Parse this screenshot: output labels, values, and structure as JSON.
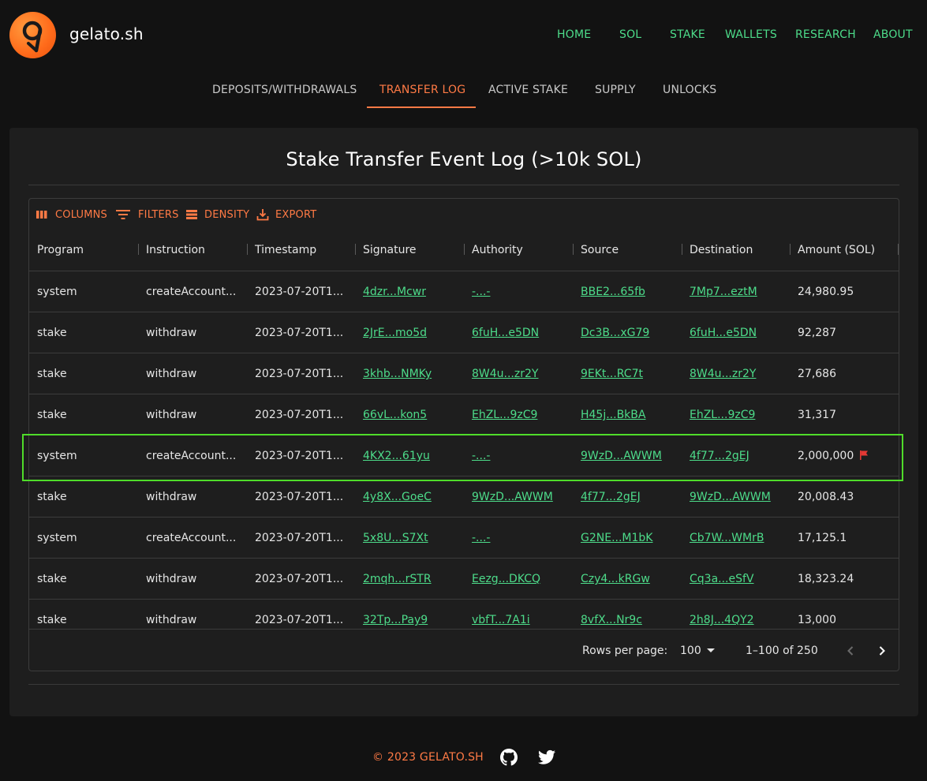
{
  "brand": {
    "name": "gelato.sh"
  },
  "nav": [
    {
      "label": "HOME"
    },
    {
      "label": "SOL"
    },
    {
      "label": "STAKE"
    },
    {
      "label": "WALLETS"
    },
    {
      "label": "RESEARCH"
    },
    {
      "label": "ABOUT"
    }
  ],
  "tabs": [
    {
      "label": "DEPOSITS/WITHDRAWALS",
      "active": false
    },
    {
      "label": "TRANSFER LOG",
      "active": true
    },
    {
      "label": "ACTIVE STAKE",
      "active": false
    },
    {
      "label": "SUPPLY",
      "active": false
    },
    {
      "label": "UNLOCKS",
      "active": false
    }
  ],
  "card": {
    "title": "Stake Transfer Event Log (>10k SOL)"
  },
  "toolbar": {
    "columns": "COLUMNS",
    "filters": "FILTERS",
    "density": "DENSITY",
    "export": "EXPORT"
  },
  "columns": [
    "Program",
    "Instruction",
    "Timestamp",
    "Signature",
    "Authority",
    "Source",
    "Destination",
    "Amount (SOL)"
  ],
  "rows": [
    {
      "program": "system",
      "instruction": "createAccount...",
      "timestamp": "2023-07-20T1...",
      "signature": "4dzr...Mcwr",
      "authority": "-...-",
      "source": "BBE2...65fb",
      "destination": "7Mp7...eztM",
      "amount": "24,980.95",
      "flagged": false
    },
    {
      "program": "stake",
      "instruction": "withdraw",
      "timestamp": "2023-07-20T1...",
      "signature": "2JrE...mo5d",
      "authority": "6fuH...e5DN",
      "source": "Dc3B...xG79",
      "destination": "6fuH...e5DN",
      "amount": "92,287",
      "flagged": false
    },
    {
      "program": "stake",
      "instruction": "withdraw",
      "timestamp": "2023-07-20T1...",
      "signature": "3khb...NMKy",
      "authority": "8W4u...zr2Y",
      "source": "9EKt...RC7t",
      "destination": "8W4u...zr2Y",
      "amount": "27,686",
      "flagged": false
    },
    {
      "program": "stake",
      "instruction": "withdraw",
      "timestamp": "2023-07-20T1...",
      "signature": "66vL...kon5",
      "authority": "EhZL...9zC9",
      "source": "H45j...BkBA",
      "destination": "EhZL...9zC9",
      "amount": "31,317",
      "flagged": false
    },
    {
      "program": "system",
      "instruction": "createAccount...",
      "timestamp": "2023-07-20T1...",
      "signature": "4KX2...61yu",
      "authority": "-...-",
      "source": "9WzD...AWWM",
      "destination": "4f77...2gEJ",
      "amount": "2,000,000",
      "flagged": true
    },
    {
      "program": "stake",
      "instruction": "withdraw",
      "timestamp": "2023-07-20T1...",
      "signature": "4y8X...GoeC",
      "authority": "9WzD...AWWM",
      "source": "4f77...2gEJ",
      "destination": "9WzD...AWWM",
      "amount": "20,008.43",
      "flagged": false
    },
    {
      "program": "system",
      "instruction": "createAccount...",
      "timestamp": "2023-07-20T1...",
      "signature": "5x8U...S7Xt",
      "authority": "-...-",
      "source": "G2NE...M1bK",
      "destination": "Cb7W...WMrB",
      "amount": "17,125.1",
      "flagged": false
    },
    {
      "program": "stake",
      "instruction": "withdraw",
      "timestamp": "2023-07-20T1...",
      "signature": "2mqh...rSTR",
      "authority": "Eezg...DKCQ",
      "source": "Czy4...kRGw",
      "destination": "Cq3a...eSfV",
      "amount": "18,323.24",
      "flagged": false
    },
    {
      "program": "stake",
      "instruction": "withdraw",
      "timestamp": "2023-07-20T1...",
      "signature": "32Tp...Pay9",
      "authority": "vbfT...7A1i",
      "source": "8vfX...Nr9c",
      "destination": "2h8J...4QY2",
      "amount": "13,000",
      "flagged": false
    }
  ],
  "pagination": {
    "rows_per_page_label": "Rows per page:",
    "rows_per_page": "100",
    "range": "1–100 of 250"
  },
  "footer": {
    "copyright": "© 2023 GELATO.SH"
  },
  "colors": {
    "accent": "#ff7a45",
    "link": "#4ddc8a",
    "highlight": "#4fdc2a",
    "flag": "#e53935"
  },
  "icons": [
    "columns-icon",
    "filters-icon",
    "density-icon",
    "export-icon",
    "flag-icon",
    "chevron-left-icon",
    "chevron-right-icon",
    "dropdown-arrow-icon",
    "github-icon",
    "twitter-icon"
  ]
}
